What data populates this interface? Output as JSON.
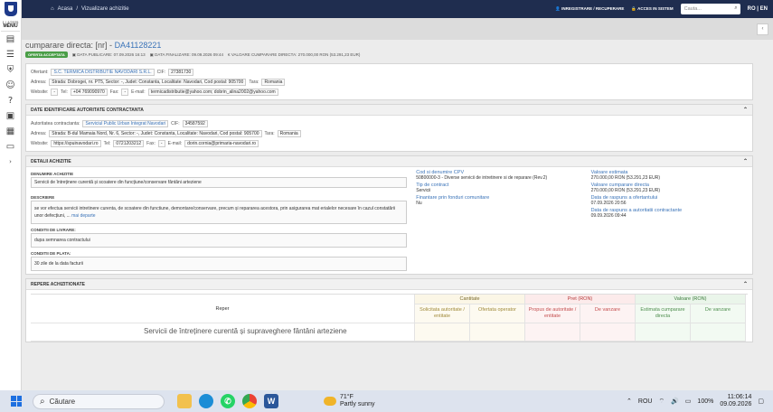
{
  "sidebar": {
    "menu_small": "1 / 4/2025",
    "menu_label": "MENIU"
  },
  "topbar": {
    "crumb_home": "Acasa",
    "crumb_sep": "/",
    "crumb_page": "Vizualizare achizitie",
    "inregistrare": "INREGISTRARE / RECUPERARE",
    "acces": "ACCES IN SISTEM",
    "search_placeholder": "Cauta...",
    "lang_ro": "RO",
    "lang_sep": "|",
    "lang_en": "EN"
  },
  "header": {
    "title_prefix": "cumparare directa: [nr] -",
    "title_code": "DA41128221",
    "badge": "OFERTA ACCEPTATA",
    "data_publicare": "DATA PUBLICARE: 07.09.2026 16:13",
    "data_finalizare": "DATA FINALIZARE: 09.09.2026 09:44",
    "valoare": "VALOARE CUMPARARE DIRECTA: 270.000,00 RON (53.291,23 EUR)"
  },
  "ofertant": {
    "label": "Ofertant:",
    "name": "S.C. TERMICA DISTRIBUTIE NAVODARI S.R.L.",
    "cif_label": "CIF:",
    "cif": "27381730",
    "adresa_label": "Adresa:",
    "adresa": "Strada: Dobrogei, nr. PT5, Sector: -, Judet: Constanta, Localitate: Navodari, Cod postal: 905700",
    "tara_label": "Tara:",
    "tara": "Romania",
    "website_label": "Website:",
    "website": "-",
    "tel_label": "Tel:",
    "tel": "+04 769090970",
    "fax_label": "Fax:",
    "fax": "-",
    "email_label": "E-mail:",
    "email": "termicadistributie@yahoo.com; dobrin_alina2002@yahoo.com"
  },
  "autoritate": {
    "section_title": "DATE IDENTIFICARE AUTORITATE CONTRACTANTA",
    "label": "Autoritatea contractanta:",
    "name": "Serviciul Public Urban Integrat Navodari",
    "cif_label": "CIF:",
    "cif": "34587592",
    "adresa_label": "Adresa:",
    "adresa": "Strada: B-dul Mamaia Nord, Nr. 6, Sector: -, Judet: Constanta, Localitate: Navodari, Cod postal: 905700",
    "tara_label": "Tara:",
    "tara": "Romania",
    "website_label": "Website:",
    "website": "https://spuinavodari.ro",
    "tel_label": "Tel:",
    "tel": "0721203212",
    "fax_label": "Fax:",
    "fax": "-",
    "email_label": "E-mail:",
    "email": "dorin.cornia@primaria-navodari.ro"
  },
  "detalii": {
    "section_title": "DETALII ACHIZITIE",
    "denumire_label": "DENUMIRE ACHIZITIE",
    "denumire": "Servicii de întreținere curentă și scoatere din funcțiune/conservare fântâni arteziene",
    "descriere_label": "DESCRIERE",
    "descriere": "se vor efectua servicii intretinere curenta, de scoatere din functiune, demontare/conservare, precum și repararea acestora, prin asigurarea mat erialelor necesare în cazul constatării unor defecțiuni, ...",
    "mai_departe": "mai departe",
    "livrare_label": "CONDITII DE LIVRARE:",
    "livrare": "dupa semnarea contractului",
    "plata_label": "CONDITII DE PLATA:",
    "plata": "30 zile de la data facturii",
    "cpv_label": "Cod si denumire CPV",
    "cpv": "50800000-3 - Diverse servicii de intretinere si de reparare (Rev.2)",
    "tip_label": "Tip de contract",
    "tip": "Servicii",
    "fonduri_label": "Finantare prin fonduri comunitare",
    "fonduri": "Nu",
    "val_est_label": "Valoare estimata",
    "val_est": "270.000,00 RON (53.291,23 EUR)",
    "val_cump_label": "Valoare cumparare directa",
    "val_cump": "270.000,00 RON (53.291,23 EUR)",
    "raspuns_of_label": "Data de raspuns a ofertantului",
    "raspuns_of": "07.09.2026 20:56",
    "raspuns_ac_label": "Data de raspuns a autoritatii contractante",
    "raspuns_ac": "09.09.2026 09:44"
  },
  "repere": {
    "section_title": "REPERE ACHIZITIONATE",
    "col_reper": "Reper",
    "grp_cantitate": "Cantitate",
    "grp_pret": "Pret (RON)",
    "grp_valoare": "Valoare (RON)",
    "sub_solicitata": "Solicitata autoritate / entitate",
    "sub_ofertata": "Ofertata operator",
    "sub_propus": "Propus de autoritate / entitate",
    "sub_vanzare_pret": "De vanzare",
    "sub_estimata": "Estimata cumparare directa",
    "sub_vanzare_val": "De vanzare",
    "row1_name": "Servicii de întreținere curentă și supraveghere fântâni arteziene"
  },
  "taskbar": {
    "search": "Căutare",
    "temp": "71°F",
    "weather": "Partly sunny",
    "lang": "ROU",
    "battery": "100%",
    "time": "11:06:14",
    "date": "09.09.2026"
  }
}
